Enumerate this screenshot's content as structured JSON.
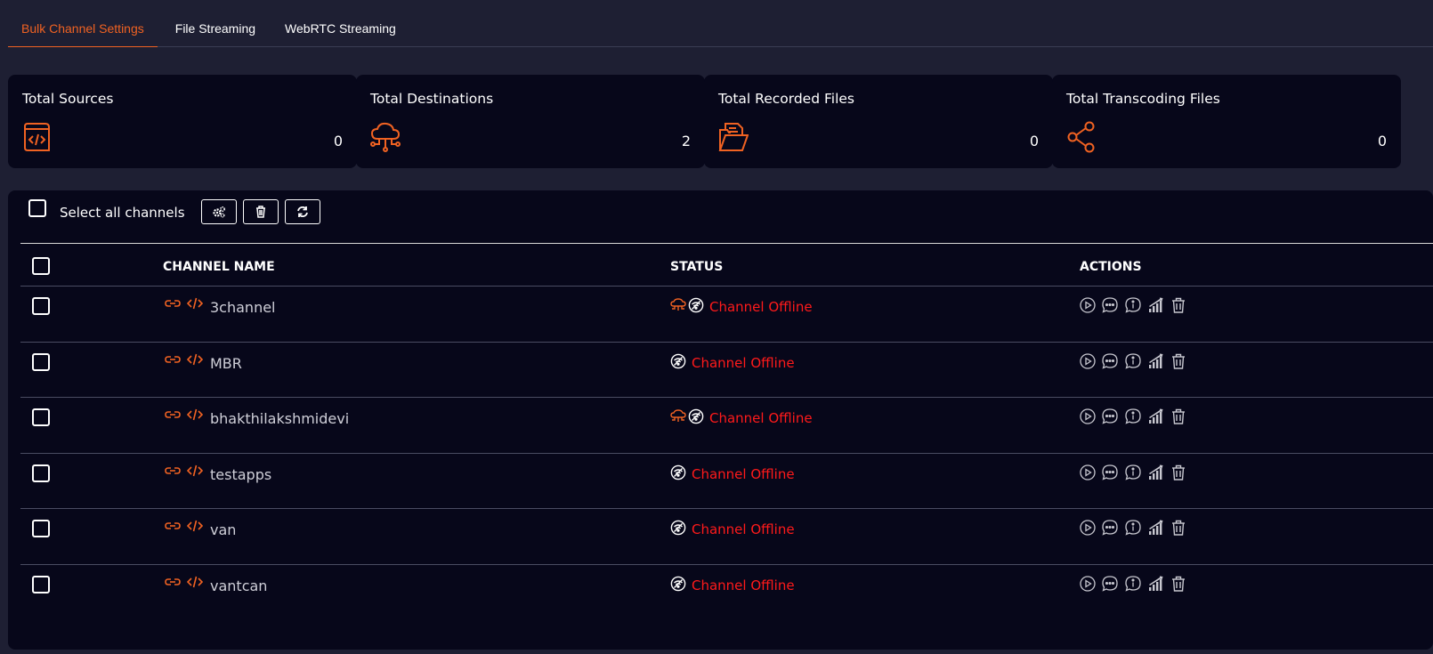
{
  "tabs": [
    {
      "label": "Bulk Channel Settings",
      "active": true
    },
    {
      "label": "File Streaming",
      "active": false
    },
    {
      "label": "WebRTC Streaming",
      "active": false
    }
  ],
  "stats": [
    {
      "title": "Total Sources",
      "value": "0",
      "icon": "code-file-icon"
    },
    {
      "title": "Total Destinations",
      "value": "2",
      "icon": "cloud-network-icon"
    },
    {
      "title": "Total Recorded Files",
      "value": "0",
      "icon": "folder-files-icon"
    },
    {
      "title": "Total Transcoding Files",
      "value": "0",
      "icon": "share-icon"
    }
  ],
  "toolbar": {
    "select_all_label": "Select all channels",
    "buttons": [
      "settings-icon",
      "trash-icon",
      "refresh-icon"
    ]
  },
  "table": {
    "headers": {
      "channel_name": "CHANNEL NAME",
      "status": "STATUS",
      "actions": "ACTIONS"
    },
    "rows": [
      {
        "name": "3channel",
        "status": "Channel Offline",
        "has_destination": true
      },
      {
        "name": "MBR",
        "status": "Channel Offline",
        "has_destination": false
      },
      {
        "name": "bhakthilakshmidevi",
        "status": "Channel Offline",
        "has_destination": true
      },
      {
        "name": "testapps",
        "status": "Channel Offline",
        "has_destination": false
      },
      {
        "name": "van",
        "status": "Channel Offline",
        "has_destination": false
      },
      {
        "name": "vantcan",
        "status": "Channel Offline",
        "has_destination": false
      }
    ],
    "action_icons": [
      "play-icon",
      "chat-icon",
      "info-icon",
      "signal-icon",
      "trash-icon"
    ]
  },
  "colors": {
    "accent": "#f06222",
    "background": "#1e1f33",
    "card": "#07071a",
    "offline": "#ff1a1a"
  }
}
